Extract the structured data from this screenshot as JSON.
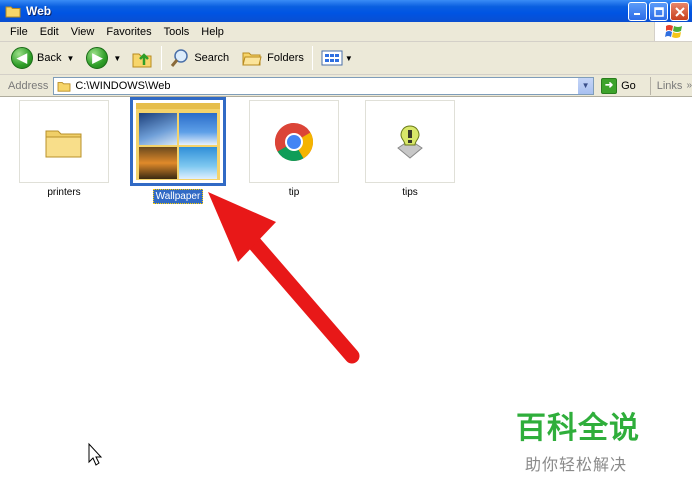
{
  "window": {
    "title": "Web",
    "icon": "folder-icon"
  },
  "menu": [
    "File",
    "Edit",
    "View",
    "Favorites",
    "Tools",
    "Help"
  ],
  "toolbar": {
    "back_label": "Back",
    "search_label": "Search",
    "folders_label": "Folders"
  },
  "address": {
    "label": "Address",
    "value": "C:\\WINDOWS\\Web",
    "go_label": "Go",
    "links_label": "Links"
  },
  "files": [
    {
      "name": "printers",
      "icon": "folder-icon",
      "selected": false
    },
    {
      "name": "Wallpaper",
      "icon": "folder-thumbnail-icon",
      "selected": true
    },
    {
      "name": "tip",
      "icon": "chrome-icon",
      "selected": false
    },
    {
      "name": "tips",
      "icon": "tips-bulb-icon",
      "selected": false
    }
  ],
  "watermark": {
    "title": "百科全说",
    "subtitle": "助你轻松解决"
  },
  "colors": {
    "titlebar": "#0054e3",
    "selection": "#316ac5",
    "arrow": "#e81818",
    "watermark": "#2fae3b"
  }
}
